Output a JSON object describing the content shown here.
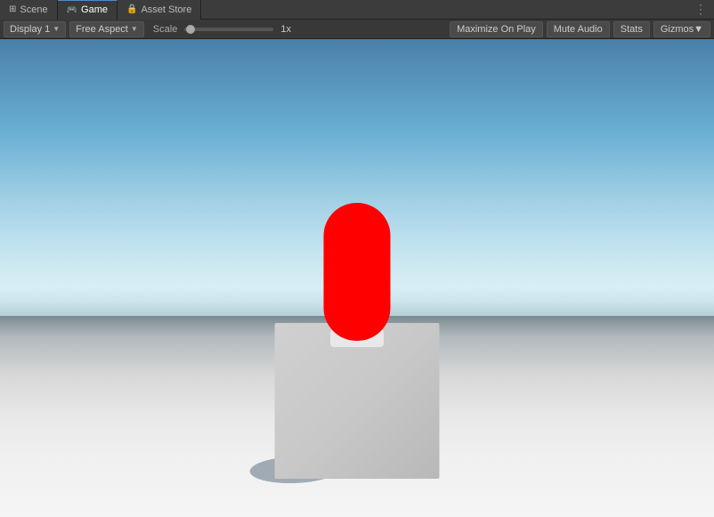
{
  "tabs": [
    {
      "id": "scene",
      "label": "Scene",
      "icon": "⊞",
      "active": false
    },
    {
      "id": "game",
      "label": "Game",
      "icon": "🎮",
      "active": true
    },
    {
      "id": "asset-store",
      "label": "Asset Store",
      "icon": "🔒",
      "active": false
    }
  ],
  "toolbar": {
    "display_label": "Display 1",
    "aspect_label": "Free Aspect",
    "scale_label": "Scale",
    "scale_value": "1x",
    "maximize_label": "Maximize On Play",
    "mute_label": "Mute Audio",
    "stats_label": "Stats",
    "gizmos_label": "Gizmos"
  },
  "more_icon": "⋮"
}
